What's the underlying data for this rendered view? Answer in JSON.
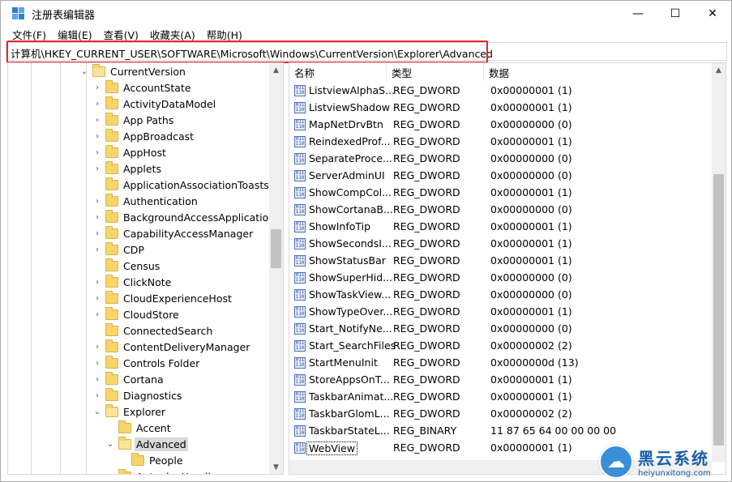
{
  "window": {
    "title": "注册表编辑器",
    "controls": {
      "minimize": "—",
      "maximize": "☐",
      "close": "✕"
    }
  },
  "menu": [
    "文件(F)",
    "编辑(E)",
    "查看(V)",
    "收藏夹(A)",
    "帮助(H)"
  ],
  "address": "计算机\\HKEY_CURRENT_USER\\SOFTWARE\\Microsoft\\Windows\\CurrentVersion\\Explorer\\Advanced",
  "tree": [
    {
      "label": "CurrentVersion",
      "level": 0,
      "expander": "⌄",
      "open": true
    },
    {
      "label": "AccountState",
      "level": 1,
      "expander": "›"
    },
    {
      "label": "ActivityDataModel",
      "level": 1,
      "expander": "›"
    },
    {
      "label": "App Paths",
      "level": 1,
      "expander": "›"
    },
    {
      "label": "AppBroadcast",
      "level": 1,
      "expander": "›"
    },
    {
      "label": "AppHost",
      "level": 1,
      "expander": "›"
    },
    {
      "label": "Applets",
      "level": 1,
      "expander": "›"
    },
    {
      "label": "ApplicationAssociationToasts",
      "level": 1,
      "expander": ""
    },
    {
      "label": "Authentication",
      "level": 1,
      "expander": "›"
    },
    {
      "label": "BackgroundAccessApplications",
      "level": 1,
      "expander": "›"
    },
    {
      "label": "CapabilityAccessManager",
      "level": 1,
      "expander": "›"
    },
    {
      "label": "CDP",
      "level": 1,
      "expander": "›"
    },
    {
      "label": "Census",
      "level": 1,
      "expander": ""
    },
    {
      "label": "ClickNote",
      "level": 1,
      "expander": "›"
    },
    {
      "label": "CloudExperienceHost",
      "level": 1,
      "expander": "›"
    },
    {
      "label": "CloudStore",
      "level": 1,
      "expander": "›"
    },
    {
      "label": "ConnectedSearch",
      "level": 1,
      "expander": ""
    },
    {
      "label": "ContentDeliveryManager",
      "level": 1,
      "expander": "›"
    },
    {
      "label": "Controls Folder",
      "level": 1,
      "expander": "›"
    },
    {
      "label": "Cortana",
      "level": 1,
      "expander": "›"
    },
    {
      "label": "Diagnostics",
      "level": 1,
      "expander": "›"
    },
    {
      "label": "Explorer",
      "level": 1,
      "expander": "⌄",
      "open": true
    },
    {
      "label": "Accent",
      "level": 2,
      "expander": ""
    },
    {
      "label": "Advanced",
      "level": 2,
      "expander": "⌄",
      "open": true,
      "selected": true
    },
    {
      "label": "People",
      "level": 3,
      "expander": ""
    },
    {
      "label": "AutoplayHandlers",
      "level": 2,
      "expander": "›"
    }
  ],
  "columns": {
    "name": "名称",
    "type": "类型",
    "data": "数据"
  },
  "values": [
    {
      "name": "ListviewAlphaS...",
      "type": "REG_DWORD",
      "data": "0x00000001 (1)"
    },
    {
      "name": "ListviewShadow",
      "type": "REG_DWORD",
      "data": "0x00000001 (1)"
    },
    {
      "name": "MapNetDrvBtn",
      "type": "REG_DWORD",
      "data": "0x00000000 (0)"
    },
    {
      "name": "ReindexedProf...",
      "type": "REG_DWORD",
      "data": "0x00000001 (1)"
    },
    {
      "name": "SeparateProce...",
      "type": "REG_DWORD",
      "data": "0x00000000 (0)"
    },
    {
      "name": "ServerAdminUI",
      "type": "REG_DWORD",
      "data": "0x00000000 (0)"
    },
    {
      "name": "ShowCompCol...",
      "type": "REG_DWORD",
      "data": "0x00000001 (1)"
    },
    {
      "name": "ShowCortanaB...",
      "type": "REG_DWORD",
      "data": "0x00000000 (0)"
    },
    {
      "name": "ShowInfoTip",
      "type": "REG_DWORD",
      "data": "0x00000001 (1)"
    },
    {
      "name": "ShowSecondsI...",
      "type": "REG_DWORD",
      "data": "0x00000001 (1)"
    },
    {
      "name": "ShowStatusBar",
      "type": "REG_DWORD",
      "data": "0x00000001 (1)"
    },
    {
      "name": "ShowSuperHid...",
      "type": "REG_DWORD",
      "data": "0x00000000 (0)"
    },
    {
      "name": "ShowTaskView...",
      "type": "REG_DWORD",
      "data": "0x00000000 (0)"
    },
    {
      "name": "ShowTypeOver...",
      "type": "REG_DWORD",
      "data": "0x00000001 (1)"
    },
    {
      "name": "Start_NotifyNe...",
      "type": "REG_DWORD",
      "data": "0x00000000 (0)"
    },
    {
      "name": "Start_SearchFiles",
      "type": "REG_DWORD",
      "data": "0x00000002 (2)"
    },
    {
      "name": "StartMenuInit",
      "type": "REG_DWORD",
      "data": "0x0000000d (13)"
    },
    {
      "name": "StoreAppsOnT...",
      "type": "REG_DWORD",
      "data": "0x00000001 (1)"
    },
    {
      "name": "TaskbarAnimat...",
      "type": "REG_DWORD",
      "data": "0x00000001 (1)"
    },
    {
      "name": "TaskbarGlomL...",
      "type": "REG_DWORD",
      "data": "0x00000002 (2)"
    },
    {
      "name": "TaskbarStateL...",
      "type": "REG_BINARY",
      "data": "11 87 65 64 00 00 00 00"
    },
    {
      "name": "WebView",
      "type": "REG_DWORD",
      "data": "0x00000001 (1)"
    }
  ],
  "watermark": {
    "cn": "黑云系统",
    "en": "heiyunxitong.com"
  }
}
